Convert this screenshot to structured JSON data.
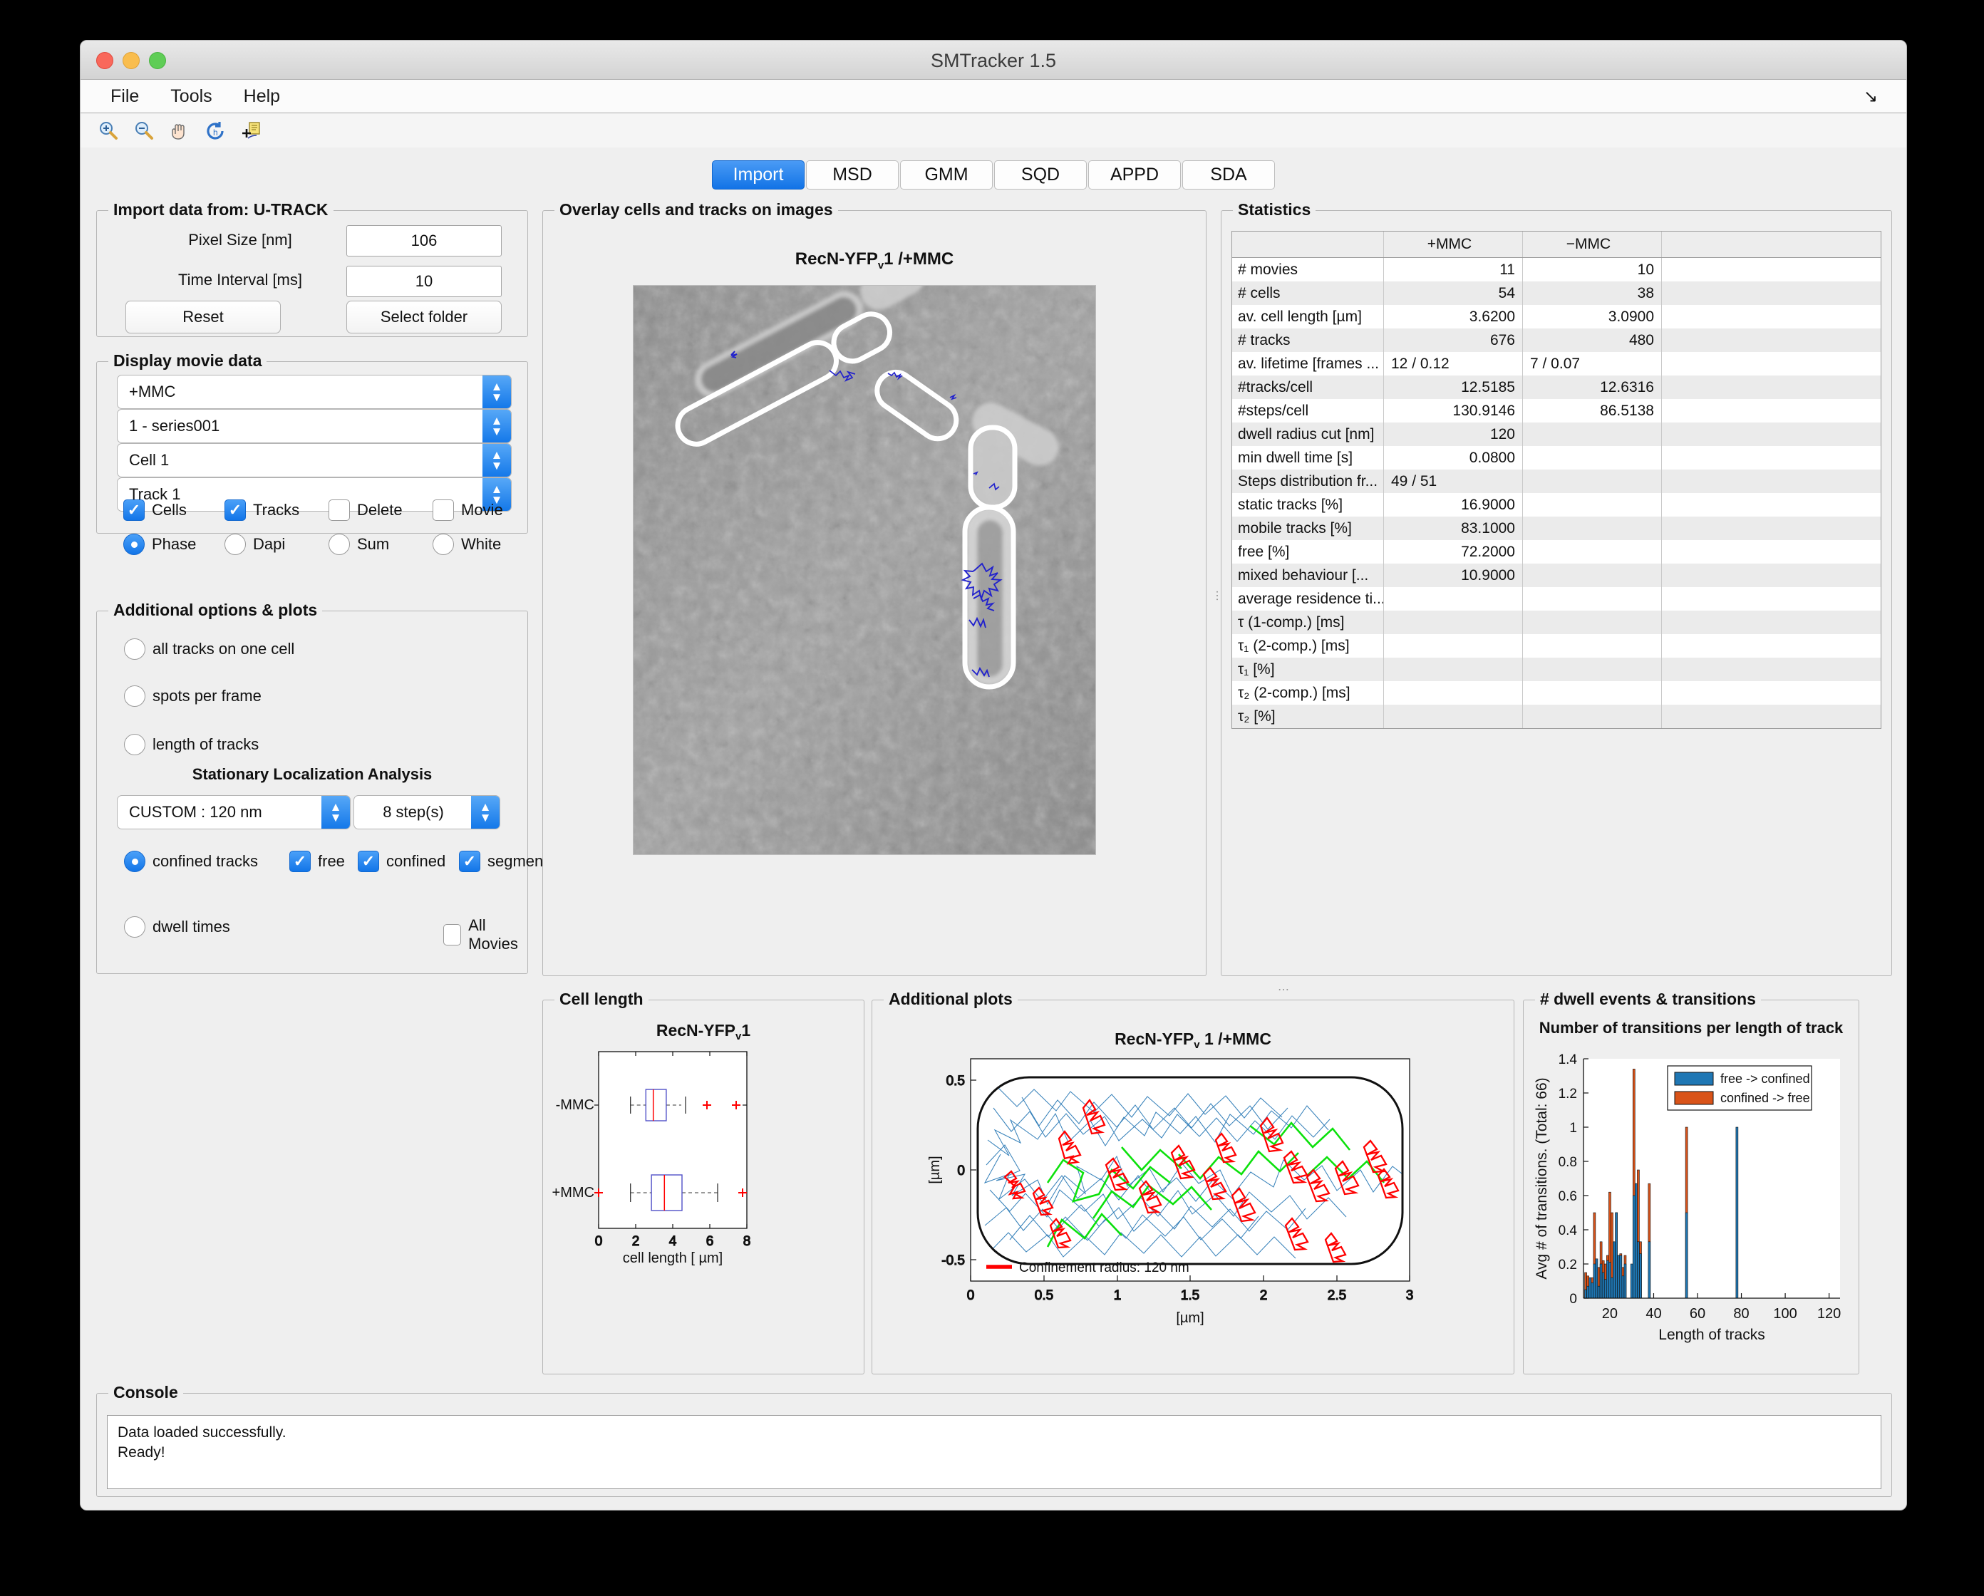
{
  "window": {
    "title": "SMTracker 1.5",
    "menu": [
      "File",
      "Tools",
      "Help"
    ],
    "menu_arrow_icon": "arrow-down-right-icon",
    "toolbar_icons": [
      "zoom-in-icon",
      "zoom-out-icon",
      "pan-hand-icon",
      "restore-view-icon",
      "data-cursor-icon"
    ]
  },
  "tabs": [
    {
      "label": "Import",
      "active": true
    },
    {
      "label": "MSD",
      "active": false
    },
    {
      "label": "GMM",
      "active": false
    },
    {
      "label": "SQD",
      "active": false
    },
    {
      "label": "APPD",
      "active": false
    },
    {
      "label": "SDA",
      "active": false
    }
  ],
  "import_panel": {
    "title": "Import data from: U-TRACK",
    "pixel_size_label": "Pixel Size [nm]",
    "pixel_size_value": "106",
    "time_interval_label": "Time Interval [ms]",
    "time_interval_value": "10",
    "reset_label": "Reset",
    "select_folder_label": "Select folder"
  },
  "display_panel": {
    "title": "Display movie data",
    "combos": [
      {
        "name": "condition",
        "value": "+MMC"
      },
      {
        "name": "movie",
        "value": "1 - series001"
      },
      {
        "name": "cell",
        "value": "Cell 1"
      },
      {
        "name": "track",
        "value": "Track 1"
      }
    ],
    "checks": [
      {
        "label": "Cells",
        "checked": true
      },
      {
        "label": "Tracks",
        "checked": true
      },
      {
        "label": "Delete",
        "checked": false
      },
      {
        "label": "Movie",
        "checked": false
      }
    ],
    "radios": [
      {
        "label": "Phase",
        "selected": true
      },
      {
        "label": "Dapi",
        "selected": false
      },
      {
        "label": "Sum",
        "selected": false
      },
      {
        "label": "White",
        "selected": false
      }
    ]
  },
  "options_panel": {
    "title": "Additional options & plots",
    "radios_top": [
      {
        "label": "all tracks on one cell",
        "selected": false
      },
      {
        "label": "spots per frame",
        "selected": false
      },
      {
        "label": "length of tracks",
        "selected": false
      }
    ],
    "sla_heading": "Stationary Localization Analysis",
    "radius_combo": "CUSTOM : 120 nm",
    "steps_combo": "8 step(s)",
    "confined_radio": {
      "label": "confined tracks",
      "selected": true
    },
    "confined_checks": [
      {
        "label": "free",
        "checked": true
      },
      {
        "label": "confined",
        "checked": true
      },
      {
        "label": "segments",
        "checked": true
      }
    ],
    "dwell_radio": {
      "label": "dwell times",
      "selected": false
    },
    "all_movies_check": {
      "label": "All Movies",
      "checked": false
    }
  },
  "overlay_panel": {
    "title": "Overlay cells and tracks on images",
    "plot_title_main": "RecN-YFP",
    "plot_title_sub": "v",
    "plot_title_tail": "1 /+MMC"
  },
  "statistics_panel": {
    "title": "Statistics",
    "columns": [
      "",
      "+MMC",
      "−MMC"
    ],
    "rows": [
      {
        "label": "# movies",
        "plus": "11",
        "minus": "10",
        "align": "right"
      },
      {
        "label": "# cells",
        "plus": "54",
        "minus": "38",
        "align": "right"
      },
      {
        "label": "av. cell length [µm]",
        "plus": "3.6200",
        "minus": "3.0900",
        "align": "right"
      },
      {
        "label": "# tracks",
        "plus": "676",
        "minus": "480",
        "align": "right"
      },
      {
        "label": "av. lifetime [frames ...",
        "plus": "12 / 0.12",
        "minus": "7 / 0.07",
        "align": "left"
      },
      {
        "label": "#tracks/cell",
        "plus": "12.5185",
        "minus": "12.6316",
        "align": "right"
      },
      {
        "label": "#steps/cell",
        "plus": "130.9146",
        "minus": "86.5138",
        "align": "right"
      },
      {
        "label": "dwell radius cut [nm]",
        "plus": "120",
        "minus": "",
        "align": "right"
      },
      {
        "label": "min dwell time [s]",
        "plus": "0.0800",
        "minus": "",
        "align": "right"
      },
      {
        "label": "Steps distribution fr...",
        "plus": "49 / 51",
        "minus": "",
        "align": "left"
      },
      {
        "label": "static tracks [%]",
        "plus": "16.9000",
        "minus": "",
        "align": "right"
      },
      {
        "label": "mobile tracks [%]",
        "plus": "83.1000",
        "minus": "",
        "align": "right"
      },
      {
        "label": "  free [%]",
        "plus": "72.2000",
        "minus": "",
        "align": "right"
      },
      {
        "label": "  mixed behaviour [...",
        "plus": "10.9000",
        "minus": "",
        "align": "right"
      },
      {
        "label": "average residence ti...",
        "plus": "",
        "minus": "",
        "align": "right"
      },
      {
        "label": "τ (1-comp.) [ms]",
        "plus": "",
        "minus": "",
        "align": "right"
      },
      {
        "label": "τ₁ (2-comp.) [ms]",
        "plus": "",
        "minus": "",
        "align": "right"
      },
      {
        "label": "τ₁ [%]",
        "plus": "",
        "minus": "",
        "align": "right"
      },
      {
        "label": "τ₂ (2-comp.) [ms]",
        "plus": "",
        "minus": "",
        "align": "right"
      },
      {
        "label": "τ₂ [%]",
        "plus": "",
        "minus": "",
        "align": "right"
      }
    ]
  },
  "cell_length_panel": {
    "title": "Cell length"
  },
  "additional_plots_panel": {
    "title": "Additional plots"
  },
  "dwell_panel": {
    "title": "# dwell events & transitions"
  },
  "console_panel": {
    "title": "Console",
    "lines": "Data loaded successfully.\nReady!"
  },
  "colors": {
    "accent_blue": "#1478e9",
    "series_free_to_confined": "#1f77b4",
    "series_confined_to_free": "#d95319",
    "track_red": "#ff0000",
    "track_green": "#00e000",
    "track_blue": "#2878b5"
  },
  "chart_data": [
    {
      "id": "cell-length-boxplot",
      "type": "box",
      "title": "RecN-YFP_v 1",
      "xlabel": "cell length [ µm]",
      "ylabel": "",
      "xlim": [
        -0.6,
        8.6
      ],
      "xticks": [
        0,
        2,
        4,
        6,
        8
      ],
      "categories": [
        "-MMC",
        "+MMC"
      ],
      "boxes": [
        {
          "category": "-MMC",
          "whisker_low": 1.72,
          "q1": 2.55,
          "median": 2.95,
          "q3": 3.65,
          "whisker_high": 4.7,
          "outliers": [
            5.63,
            7.2
          ]
        },
        {
          "category": "+MMC",
          "whisker_low": 1.72,
          "q1": 2.85,
          "median": 3.55,
          "q3": 4.5,
          "whisker_high": 6.45,
          "outliers": [
            0.0,
            7.85
          ]
        }
      ],
      "box_color": "#5050c8",
      "median_color": "#ff0000",
      "outlier_color": "#ff0000"
    },
    {
      "id": "confined-tracks-cell-map",
      "type": "scatter",
      "title": "RecN-YFP_v 1 /+MMC",
      "xlabel": "[µm]",
      "ylabel": "[µm]",
      "xlim": [
        0,
        3.15
      ],
      "ylim": [
        -0.62,
        0.62
      ],
      "xticks": [
        0,
        0.5,
        1,
        1.5,
        2,
        2.5,
        3
      ],
      "yticks": [
        -0.5,
        0,
        0.5
      ],
      "legend": [
        {
          "label": "Confinement radius: 120 nm",
          "color": "#ff0000"
        }
      ],
      "series": [
        {
          "name": "free tracks",
          "color": "#2878b5"
        },
        {
          "name": "confined tracks",
          "color": "#ff0000"
        },
        {
          "name": "segments",
          "color": "#00e000"
        }
      ],
      "cell_outline": {
        "shape": "rounded-rod",
        "x_start": 0.05,
        "x_end": 2.98,
        "y_top": 0.49,
        "y_bottom": -0.49
      }
    },
    {
      "id": "transitions-per-track-length",
      "type": "bar",
      "title": "Number of transitions per length of track",
      "xlabel": "Length of tracks",
      "ylabel": "Avg # of transitions. (Total: 66)",
      "xlim": [
        8,
        125
      ],
      "ylim": [
        0,
        1.4
      ],
      "yticks": [
        0,
        0.2,
        0.4,
        0.6,
        0.8,
        1,
        1.2,
        1.4
      ],
      "xticks": [
        20,
        40,
        60,
        80,
        100,
        120
      ],
      "legend_position": "top-right",
      "legend": [
        {
          "label": "free -> confined",
          "color": "#1f77b4"
        },
        {
          "label": "confined -> free",
          "color": "#d95319"
        }
      ],
      "x": [
        9,
        10,
        11,
        12,
        13,
        14,
        15,
        16,
        17,
        18,
        19,
        20,
        21,
        22,
        23,
        24,
        25,
        26,
        27,
        28,
        29,
        30,
        31,
        32,
        33,
        34,
        35,
        36,
        38,
        41,
        55,
        78
      ],
      "series": [
        {
          "name": "free -> confined",
          "values": [
            0.05,
            0.07,
            0.12,
            0.09,
            0.2,
            0.23,
            0.07,
            0.2,
            0.15,
            0.11,
            0.22,
            0.21,
            0.12,
            0.33,
            0.5,
            0.25,
            0.25,
            0.13,
            0.2,
            0.0,
            0.0,
            0.2,
            0.6,
            0.67,
            0.33,
            0.26,
            0.0,
            0.0,
            0.33,
            0.0,
            0.5,
            1.0
          ]
        },
        {
          "name": "confined -> free",
          "values": [
            0.15,
            0.13,
            0.11,
            0.12,
            0.5,
            0.18,
            0.18,
            0.33,
            0.22,
            0.2,
            0.25,
            0.62,
            0.5,
            0.25,
            0.5,
            0.25,
            0.26,
            0.18,
            0.25,
            0.0,
            0.0,
            0.0,
            1.34,
            0.67,
            0.75,
            0.33,
            0.0,
            0.0,
            0.67,
            0.0,
            1.0,
            0.0
          ]
        }
      ]
    }
  ]
}
